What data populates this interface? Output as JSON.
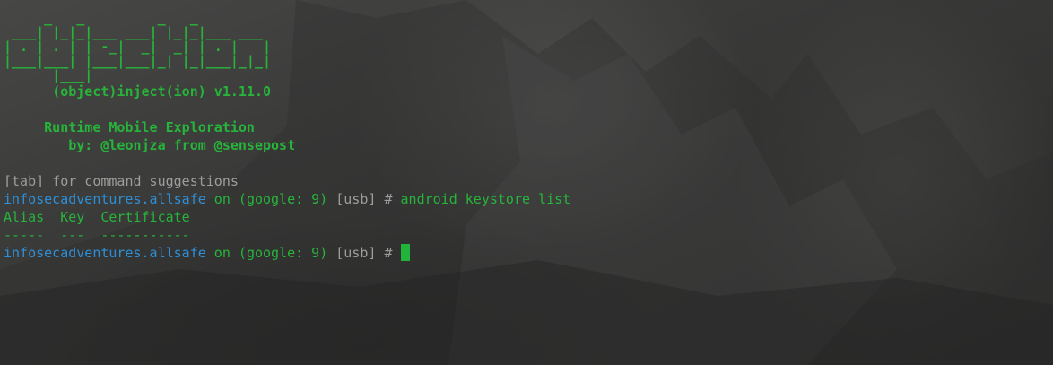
{
  "banner": {
    "ascii_art": "     _   _         _   _\n ___| |_|_|___ ___| |_|_|___ ___\n| . | . | | -_|  _|  _| | . |   |\n|___|___| |___|___|_| |_|___|_|_|\n      |___|",
    "version_line": "(object)inject(ion) v1.11.0",
    "tagline": "Runtime Mobile Exploration",
    "byline": "by: @leonjza from @sensepost"
  },
  "hint": "[tab] for command suggestions",
  "prompt": {
    "app": "infosecadventures.allsafe",
    "on": " on ",
    "device_open": "(",
    "device": "google: 9",
    "device_close": ")",
    "transport": " [usb] ",
    "symbol": "# "
  },
  "history": [
    {
      "command": "android keystore list"
    }
  ],
  "output": {
    "header": "Alias  Key  Certificate",
    "separator": "-----  ---  -----------"
  },
  "colors": {
    "green": "#27b43a",
    "blue": "#2d8fd8",
    "gray": "#9d9d9d",
    "cursor": "#22b33b"
  }
}
